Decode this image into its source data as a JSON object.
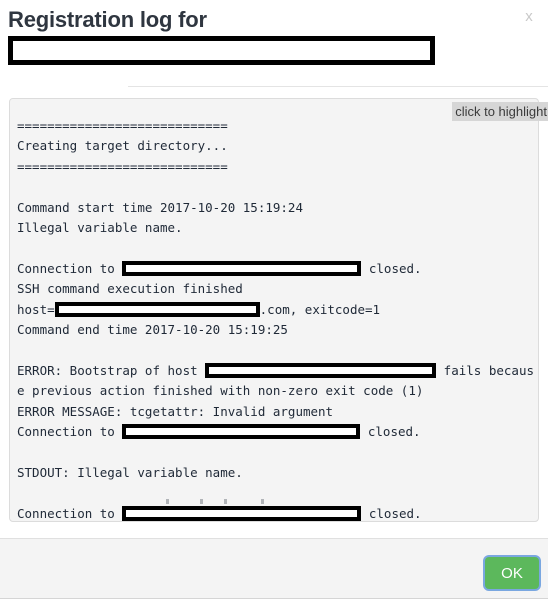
{
  "dialog": {
    "title": "Registration log for",
    "close_icon_label": "x",
    "redacted_subject": "",
    "highlight_hint": "click to highlight",
    "ok_label": "OK"
  },
  "log": {
    "separator": "============================",
    "lines": [
      {
        "type": "text",
        "text": "============================"
      },
      {
        "type": "text",
        "text": "Creating target directory..."
      },
      {
        "type": "text",
        "text": "============================"
      },
      {
        "type": "blank"
      },
      {
        "type": "text",
        "text": "Command start time 2017-10-20 15:19:24"
      },
      {
        "type": "text",
        "text": "Illegal variable name."
      },
      {
        "type": "blank"
      },
      {
        "type": "redacted",
        "before": "Connection to ",
        "after": " closed."
      },
      {
        "type": "text",
        "text": "SSH command execution finished"
      },
      {
        "type": "redacted",
        "before": "host=",
        "after": ".com, exitcode=1"
      },
      {
        "type": "text",
        "text": "Command end time 2017-10-20 15:19:25"
      },
      {
        "type": "blank"
      },
      {
        "type": "redacted",
        "before": "ERROR: Bootstrap of host ",
        "after": " fails becaus"
      },
      {
        "type": "text",
        "text": "e previous action finished with non-zero exit code (1)"
      },
      {
        "type": "text",
        "text": "ERROR MESSAGE: tcgetattr: Invalid argument"
      },
      {
        "type": "redacted",
        "before": "Connection to ",
        "after": " closed."
      },
      {
        "type": "blank"
      },
      {
        "type": "text",
        "text": "STDOUT: Illegal variable name."
      },
      {
        "type": "blank"
      },
      {
        "type": "redacted",
        "before": "Connection to ",
        "after": " closed."
      }
    ],
    "segments": {
      "l1": "============================",
      "l2": "Creating target directory...",
      "l3": "============================",
      "l5": "Command start time 2017-10-20 15:19:24",
      "l6": "Illegal variable name.",
      "l8a": "Connection to ",
      "l8b": " closed.",
      "l9": "SSH command execution finished",
      "l10a": "host=",
      "l10b": ".com, exitcode=1",
      "l11": "Command end time 2017-10-20 15:19:25",
      "l13a": "ERROR: Bootstrap of host ",
      "l13b": " fails becaus",
      "l14": "e previous action finished with non-zero exit code (1)",
      "l15": "ERROR MESSAGE: tcgetattr: Invalid argument",
      "l16a": "Connection to ",
      "l16b": " closed.",
      "l18": "STDOUT: Illegal variable name.",
      "l20a": "Connection to ",
      "l20b": " closed."
    }
  },
  "colors": {
    "ok_button": "#5cb85c",
    "focus_ring": "#7aa7e0",
    "panel_bg": "#f4f4f4",
    "title_text": "#2f3640",
    "redaction": "#000000",
    "hint_bg": "#d6d6d6"
  }
}
